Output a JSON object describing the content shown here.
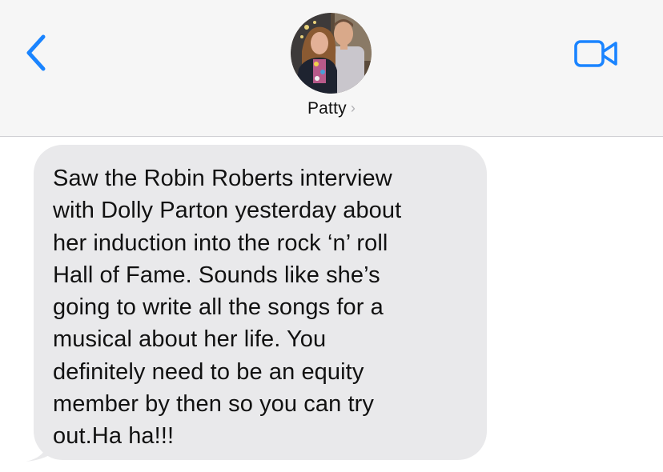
{
  "header": {
    "contact_name": "Patty",
    "name_chevron": "›",
    "back_icon": "chevron-left-icon",
    "video_icon": "video-camera-icon",
    "accent_color": "#1a84ff",
    "background_color": "#f6f6f6"
  },
  "messages": [
    {
      "direction": "incoming",
      "bubble_color": "#e9e9eb",
      "lines": [
        "Saw the Robin Roberts interview",
        "with Dolly Parton yesterday about",
        "her induction into the rock ‘n’ roll",
        "Hall of Fame. Sounds like she’s",
        "going to write all the songs for a",
        "musical about her life. You",
        "definitely need to be an equity",
        "member by then so you can try",
        "out.Ha ha!!!"
      ]
    }
  ]
}
